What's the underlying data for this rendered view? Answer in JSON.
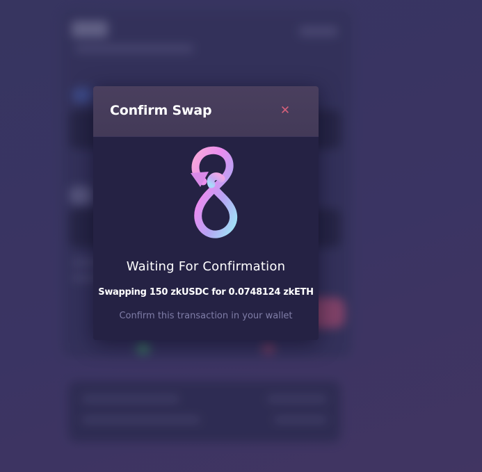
{
  "modal": {
    "title": "Confirm Swap",
    "close_symbol": "✕",
    "status_title": "Waiting For Confirmation",
    "swap_description": "Swapping 150 zkUSDC for 0.0748124 zkETH",
    "wallet_hint": "Confirm this transaction in your wallet",
    "logo_icon": "infinity-swap-logo-icon",
    "close_icon": "close-icon"
  },
  "colors": {
    "background": "#3f3a69",
    "modal_body": "#252244",
    "modal_header": "#473d5c",
    "close_accent": "#d6607a",
    "hint_text": "#807ea8"
  }
}
